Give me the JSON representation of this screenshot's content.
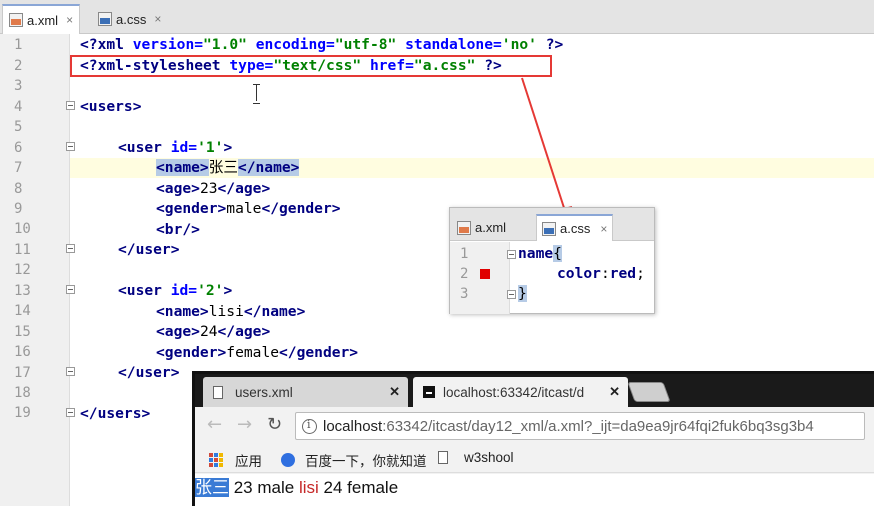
{
  "editor": {
    "tabs": [
      {
        "label": "a.xml",
        "icon": "xml-file-icon",
        "close": "×"
      },
      {
        "label": "a.css",
        "icon": "css-file-icon",
        "close": "×"
      }
    ],
    "line_numbers": [
      "1",
      "2",
      "3",
      "4",
      "5",
      "6",
      "7",
      "8",
      "9",
      "10",
      "11",
      "12",
      "13",
      "14",
      "15",
      "16",
      "17",
      "18",
      "19"
    ],
    "code": {
      "l1": {
        "open": "<?",
        "tag": "xml",
        "attr1": " version=",
        "val1": "\"1.0\"",
        "attr2": " encoding=",
        "val2": "\"utf-8\"",
        "attr3": " standalone=",
        "val3": "'no'",
        "close": " ?>"
      },
      "l2": {
        "open": "<?",
        "tag": "xml-stylesheet",
        "attr1": " type=",
        "val1": "\"text/css\"",
        "attr2": " href=",
        "val2": "\"a.css\"",
        "close": " ?>"
      },
      "l4": "<users>",
      "l6": {
        "open": "<user",
        "attr": " id=",
        "val": "'1'",
        "close": ">"
      },
      "l7": {
        "open": "<name>",
        "text": "张三",
        "close": "</name>"
      },
      "l8": {
        "open": "<age>",
        "text": "23",
        "close": "</age>"
      },
      "l9": {
        "open": "<gender>",
        "text": "male",
        "close": "</gender>"
      },
      "l10": "<br/>",
      "l11": "</user>",
      "l13": {
        "open": "<user",
        "attr": " id=",
        "val": "'2'",
        "close": ">"
      },
      "l14": {
        "open": "<name>",
        "text": "lisi",
        "close": "</name>"
      },
      "l15": {
        "open": "<age>",
        "text": "24",
        "close": "</age>"
      },
      "l16": {
        "open": "<gender>",
        "text": "female",
        "close": "</gender>"
      },
      "l17": "</user>",
      "l19": "</users>"
    }
  },
  "css_popup": {
    "tabs": [
      {
        "label": "a.xml",
        "icon": "xml-file-icon"
      },
      {
        "label": "a.css",
        "icon": "css-file-icon",
        "close": "×"
      }
    ],
    "line_numbers": [
      "1",
      "2",
      "3"
    ],
    "l1_selector": "name",
    "l1_brace": "{",
    "l2_prop": "color",
    "l2_sep": ":",
    "l2_value": "red",
    "l2_end": ";",
    "l3_brace": "}",
    "colors": {
      "breakpoint": "#e00000"
    }
  },
  "browser": {
    "tabs": [
      {
        "label": "users.xml",
        "close": "✕"
      },
      {
        "label": "localhost:63342/itcast/d",
        "close": "✕"
      }
    ],
    "nav": {
      "back": "←",
      "forward": "→",
      "reload": "↻"
    },
    "url": {
      "host": "localhost",
      "path": ":63342/itcast/day12_xml/a.xml?_ijt=da9ea9jr64fqi2fuk6bq3sg3b4"
    },
    "bookmarks": [
      {
        "label": "应用",
        "icon": "apps-grid-icon"
      },
      {
        "label": "百度一下，你就知道",
        "icon": "baidu-paw-icon"
      },
      {
        "label": "w3shool",
        "icon": "page-icon"
      }
    ],
    "page_text": {
      "name1": "张三",
      "rest1": " 23 male ",
      "name2": "lisi",
      "rest2": " 24 female"
    }
  },
  "colors": {
    "annotation": "#e53935",
    "css_red": "#c62828",
    "selection": "#3a7bd5"
  }
}
